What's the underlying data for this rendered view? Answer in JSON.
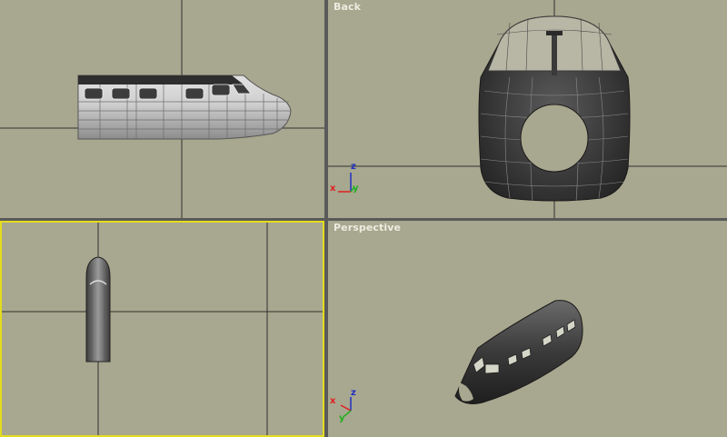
{
  "viewports": {
    "top_left": {
      "label": ""
    },
    "top_right": {
      "label": "Back"
    },
    "bottom_left": {
      "label": ""
    },
    "bottom_right": {
      "label": "Perspective"
    }
  },
  "axis_gizmo": {
    "x": "x",
    "y": "y",
    "z": "z"
  },
  "colors": {
    "viewport_bg": "#a8a78f",
    "divider": "#5a5a5a",
    "active_border": "#e3dc1e",
    "grid_line": "#303030",
    "mesh_light": "#c8c8c8",
    "mesh_dark": "#3a3a3a",
    "axis_x": "#e02020",
    "axis_y": "#1fb01f",
    "axis_z": "#2030c0"
  }
}
